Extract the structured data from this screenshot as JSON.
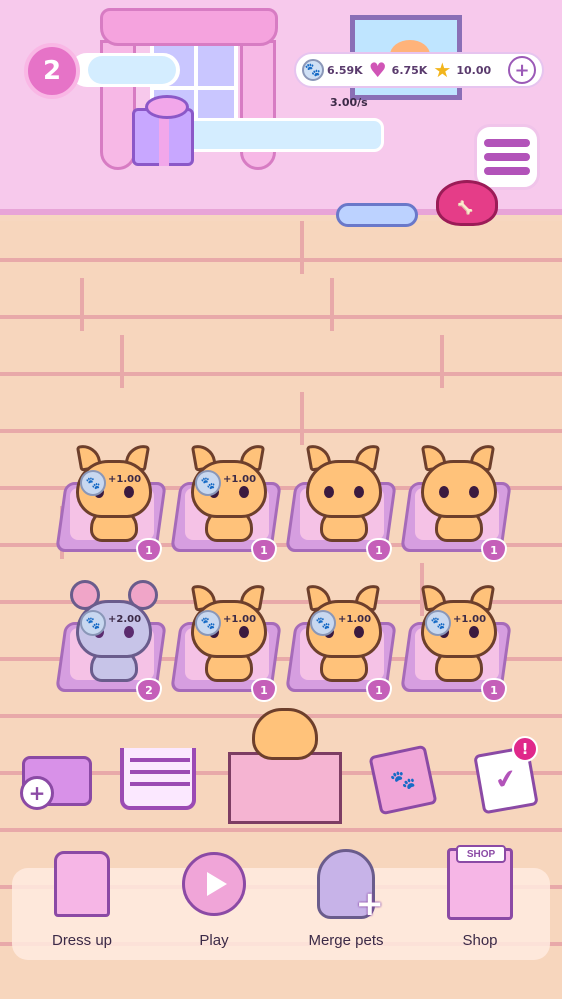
{
  "player": {
    "level": "2"
  },
  "currencies": {
    "paws": "6.59K",
    "hearts": "6.75K",
    "stars": "10.00",
    "rate": "3.00/s"
  },
  "pets": [
    {
      "kind": "cat",
      "gain": "+1.00",
      "level": "1"
    },
    {
      "kind": "cat",
      "gain": "+1.00",
      "level": "1"
    },
    {
      "kind": "cat",
      "gain": "",
      "level": "1"
    },
    {
      "kind": "cat",
      "gain": "",
      "level": "1"
    },
    {
      "kind": "mouse",
      "gain": "+2.00",
      "level": "2"
    },
    {
      "kind": "cat",
      "gain": "+1.00",
      "level": "1"
    },
    {
      "kind": "cat",
      "gain": "+1.00",
      "level": "1"
    },
    {
      "kind": "cat",
      "gain": "+1.00",
      "level": "1"
    }
  ],
  "actions": {
    "alert_badge": "!"
  },
  "nav": {
    "dress_up": "Dress up",
    "play": "Play",
    "merge_pets": "Merge pets",
    "shop": "Shop",
    "shop_sign": "SHOP"
  },
  "icons": [
    "paw-coin-icon",
    "heart-icon",
    "star-icon",
    "plus-icon",
    "menu-icon",
    "gift-icon",
    "cart-icon",
    "pet-box-icon",
    "paw-book-icon",
    "task-list-icon",
    "dress-icon",
    "candy-play-icon",
    "plush-merge-icon",
    "shop-icon"
  ],
  "colors": {
    "wall": "#f7c9ec",
    "floor": "#f7d6bd",
    "accent": "#b253b9"
  }
}
